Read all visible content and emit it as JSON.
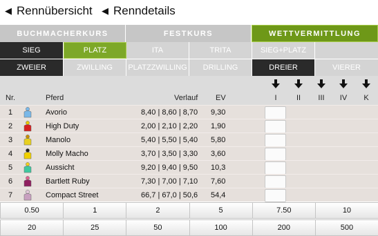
{
  "header": {
    "crumb1": "Rennübersicht",
    "crumb2": "Renndetails"
  },
  "tabs": [
    {
      "label": "BUCHMACHERKURS",
      "active": false
    },
    {
      "label": "FESTKURS",
      "active": false
    },
    {
      "label": "WETTVERMITTLUNG",
      "active": true
    }
  ],
  "bet_types_row1": [
    {
      "label": "SIEG",
      "state": "dark"
    },
    {
      "label": "PLATZ",
      "state": "selected"
    },
    {
      "label": "ITA",
      "state": "normal"
    },
    {
      "label": "TRITA",
      "state": "normal"
    },
    {
      "label": "SIEG+PLATZ",
      "state": "normal"
    },
    {
      "label": "",
      "state": "normal"
    }
  ],
  "bet_types_row2": [
    {
      "label": "ZWEIER",
      "state": "dark"
    },
    {
      "label": "ZWILLING",
      "state": "normal"
    },
    {
      "label": "PLATZZWILLING",
      "state": "normal"
    },
    {
      "label": "DRILLING",
      "state": "normal"
    },
    {
      "label": "DREIER",
      "state": "dark"
    },
    {
      "label": "VIERER",
      "state": "normal"
    }
  ],
  "table": {
    "col_nr": "Nr.",
    "col_pferd": "Pferd",
    "col_verlauf": "Verlauf",
    "col_ev": "EV",
    "wheel_labels": [
      "I",
      "II",
      "III",
      "IV",
      "K"
    ],
    "rows": [
      {
        "nr": "1",
        "name": "Avorio",
        "verlauf": "8,40 | 8,60 | 8,70",
        "ev": "9,30",
        "silk": [
          "#7ab8e8",
          "#7ab8e8"
        ]
      },
      {
        "nr": "2",
        "name": "High Duty",
        "verlauf": "2,00 | 2,10 | 2,20",
        "ev": "1,90",
        "silk": [
          "#d62020",
          "#e8c800"
        ]
      },
      {
        "nr": "3",
        "name": "Manolo",
        "verlauf": "5,40 | 5,50 | 5,40",
        "ev": "5,80",
        "silk": [
          "#e8d020",
          "#c89000"
        ]
      },
      {
        "nr": "4",
        "name": "Molly Macho",
        "verlauf": "3,70 | 3,50 | 3,30",
        "ev": "3,60",
        "silk": [
          "#f0d000",
          "#222222"
        ]
      },
      {
        "nr": "5",
        "name": "Aussicht",
        "verlauf": "9,20 | 9,40 | 9,50",
        "ev": "10,3",
        "silk": [
          "#40c8a0",
          "#f0d020"
        ]
      },
      {
        "nr": "6",
        "name": "Bartlett Ruby",
        "verlauf": "7,30 | 7,00 | 7,10",
        "ev": "7,60",
        "silk": [
          "#902060",
          "#e06090"
        ]
      },
      {
        "nr": "7",
        "name": "Compact Street",
        "verlauf": "66,7 | 67,0 | 50,6",
        "ev": "54,4",
        "silk": [
          "#c8a0c0",
          "#e0c8d8"
        ]
      }
    ]
  },
  "stakes_row1": [
    "0.50",
    "1",
    "2",
    "5",
    "7.50",
    "10"
  ],
  "stakes_row2": [
    "20",
    "25",
    "50",
    "100",
    "200",
    "500"
  ],
  "colors": {
    "accent_green": "#6e9818",
    "dark_button": "#2a2a2a",
    "row_bg": "#e6e0dc"
  }
}
